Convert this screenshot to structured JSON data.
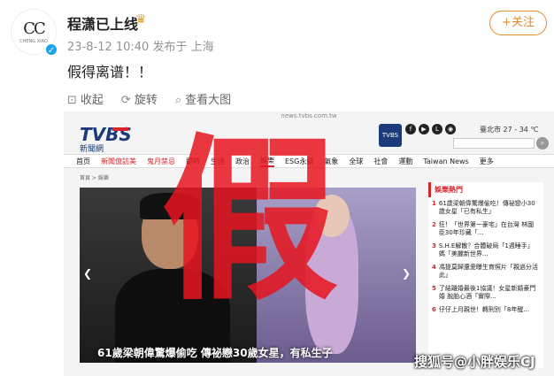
{
  "user": {
    "name": "程潇已上线",
    "meta": "23-8-12 10:40 发布于 上海",
    "avatar_text": "CC",
    "avatar_sub": "CHENG XIAO"
  },
  "follow_label": "+关注",
  "post_text": "假得离谱！！",
  "actions": [
    "收起",
    "旋转",
    "查看大图"
  ],
  "screenshot": {
    "url": "news.tvbs.com.tw",
    "logo": "TVBS",
    "logo_sub": "新聞網",
    "weather": "臺北市 27 - 34 ℃",
    "nav": [
      "首页",
      "新聞億訪美",
      "鬼月禁忌",
      "即時",
      "生活",
      "政治",
      "娛樂",
      "ESG永續",
      "氣象",
      "全球",
      "社會",
      "運動",
      "Taiwan News",
      "更多"
    ],
    "breadcrumb": "首頁 > 娛樂",
    "caption": "61歲梁朝偉驚爆偷吃 傳祕戀30歲女星，有私生子",
    "sidebar_title": "娛樂熱門",
    "sidebar_items": [
      {
        "n": "1",
        "t": "61歲梁朝偉驚爆偷吃！傳祕戀小30歲女星「已有私生」"
      },
      {
        "n": "2",
        "t": "狂！「世界第一豪宅」在台灣 林國臣30年珍藏「..."
      },
      {
        "n": "3",
        "t": "S.H.E解散？合體破局「1週睡手」 媽「美麗新世界..."
      },
      {
        "n": "4",
        "t": "馮提莫歸還愛曝生育照片「親過分活此」"
      },
      {
        "n": "5",
        "t": "了結離婚最後1協議！女星新婚豪門婚 脫胎心酒「實際..."
      },
      {
        "n": "6",
        "t": "仔仔上月親世！轉刑別「8年醒..."
      }
    ],
    "overlay_char": "假"
  },
  "watermark": "搜狐号@小胖娱乐CJ"
}
